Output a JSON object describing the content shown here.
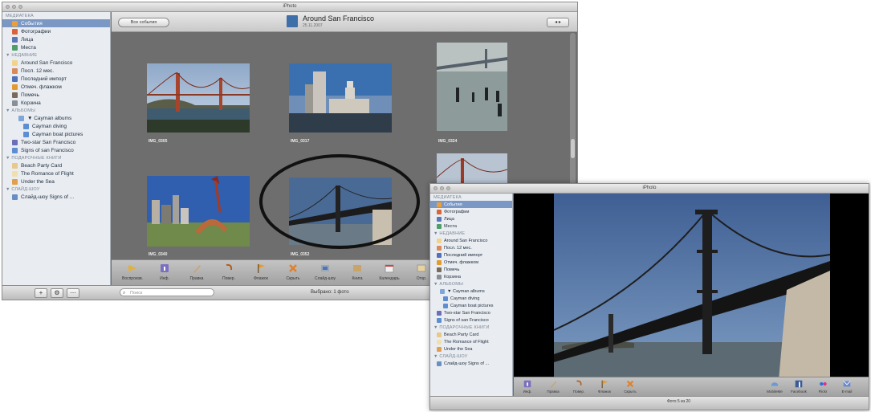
{
  "main_window": {
    "title": "iPhoto",
    "sidebar": {
      "sections": [
        {
          "header": "МЕДИАТЕКА",
          "items": [
            {
              "label": "События",
              "icon": "events-icon",
              "color": "#e9a03a",
              "indent": 0,
              "selected": true
            },
            {
              "label": "Фотографии",
              "icon": "photos-icon",
              "color": "#d9643a",
              "indent": 0
            },
            {
              "label": "Лица",
              "icon": "faces-icon",
              "color": "#5a78b8",
              "indent": 0
            },
            {
              "label": "Места",
              "icon": "places-icon",
              "color": "#4f9e6a",
              "indent": 0
            }
          ]
        },
        {
          "header": "▼ НЕДАВНИЕ",
          "items": [
            {
              "label": "Around San Francisco",
              "icon": "event-album-icon",
              "color": "#f1d48a",
              "indent": 0
            },
            {
              "label": "Посл. 12 мес.",
              "icon": "calendar-icon",
              "color": "#d98a5a",
              "indent": 0
            },
            {
              "label": "Последний импорт",
              "icon": "import-icon",
              "color": "#4f72b8",
              "indent": 0
            },
            {
              "label": "Отмеч. флажком",
              "icon": "flag-icon",
              "color": "#e29b2e",
              "indent": 0
            },
            {
              "label": "Помечь",
              "icon": "flagged-icon",
              "color": "#7a6a5a",
              "indent": 0
            },
            {
              "label": "Корзина",
              "icon": "trash-icon",
              "color": "#8a8f96",
              "indent": 0
            }
          ]
        },
        {
          "header": "▼ АЛЬБОМЫ",
          "items": [
            {
              "label": "▼ Cayman albums",
              "icon": "folder-icon",
              "color": "#7fa6d8",
              "indent": 1
            },
            {
              "label": "Cayman diving",
              "icon": "album-icon",
              "color": "#5d8ed1",
              "indent": 2
            },
            {
              "label": "Cayman boat pictures",
              "icon": "album-icon",
              "color": "#5d8ed1",
              "indent": 2
            },
            {
              "label": "Two-star San Francisco",
              "icon": "smart-album-icon",
              "color": "#6a6fb8",
              "indent": 0
            },
            {
              "label": "Signs of san Francisco",
              "icon": "smart-album-icon",
              "color": "#5d8ed1",
              "indent": 0
            }
          ]
        },
        {
          "header": "▼ ПОДАРОЧНЫЕ КНИГИ",
          "items": [
            {
              "label": "Beach Party Card",
              "icon": "card-icon",
              "color": "#e7c98a",
              "indent": 0
            },
            {
              "label": "The Romance of Flight",
              "icon": "book-icon",
              "color": "#f0e0b0",
              "indent": 0
            },
            {
              "label": "Under the Sea",
              "icon": "calendar-book-icon",
              "color": "#e0a050",
              "indent": 0
            }
          ]
        },
        {
          "header": "▼ СЛАЙД-ШОУ",
          "items": [
            {
              "label": "Слайд-шоу Signs of ...",
              "icon": "slideshow-icon",
              "color": "#6a8ec4",
              "indent": 0
            }
          ]
        }
      ],
      "bottom_buttons": [
        "+",
        "⚙",
        "⋯"
      ]
    },
    "event_header": {
      "back_label": "Все события",
      "title": "Around San Francisco",
      "subtitle": "25.11.2007",
      "nav_label": "◂ ▸"
    },
    "photos": [
      {
        "label": "IMG_0305",
        "scene": "golden-gate"
      },
      {
        "label": "IMG_0317",
        "scene": "ferry-building"
      },
      {
        "label": "IMG_0324",
        "scene": "bay-pilings"
      },
      {
        "label": "IMG_0340",
        "scene": "cupid-arrow"
      },
      {
        "label": "IMG_0352",
        "scene": "bay-bridge"
      },
      {
        "label": "",
        "scene": "golden-gate-partial"
      }
    ],
    "toolbar": [
      {
        "label": "Воспроизв.",
        "icon": "play-icon"
      },
      {
        "label": "Инф.",
        "icon": "info-icon"
      },
      {
        "label": "Правка",
        "icon": "edit-icon"
      },
      {
        "label": "Повер.",
        "icon": "rotate-icon"
      },
      {
        "label": "Флажок",
        "icon": "flag-icon"
      },
      {
        "label": "Скрыть",
        "icon": "hide-icon"
      },
      {
        "label": "Слайд-шоу",
        "icon": "slideshow-icon"
      },
      {
        "label": "Книга",
        "icon": "book-icon"
      },
      {
        "label": "Календарь",
        "icon": "calendar-icon"
      },
      {
        "label": "Откр.",
        "icon": "card-icon"
      }
    ],
    "search_placeholder": "Поиск",
    "status": "Выбрано: 1 фото"
  },
  "second_window": {
    "title": "iPhoto",
    "sidebar": {
      "sections": [
        {
          "header": "МЕДИАТЕКА",
          "items": [
            {
              "label": "События",
              "icon": "events-icon",
              "color": "#e9a03a",
              "indent": 0,
              "selected": true
            },
            {
              "label": "Фотографии",
              "icon": "photos-icon",
              "color": "#d9643a",
              "indent": 0
            },
            {
              "label": "Лица",
              "icon": "faces-icon",
              "color": "#5a78b8",
              "indent": 0
            },
            {
              "label": "Места",
              "icon": "places-icon",
              "color": "#4f9e6a",
              "indent": 0
            }
          ]
        },
        {
          "header": "▼ НЕДАВНИЕ",
          "items": [
            {
              "label": "Around San Francisco",
              "icon": "event-album-icon",
              "color": "#f1d48a",
              "indent": 0
            },
            {
              "label": "Посл. 12 мес.",
              "icon": "calendar-icon",
              "color": "#d98a5a",
              "indent": 0
            },
            {
              "label": "Последний импорт",
              "icon": "import-icon",
              "color": "#4f72b8",
              "indent": 0
            },
            {
              "label": "Отмеч. флажком",
              "icon": "flag-icon",
              "color": "#e29b2e",
              "indent": 0
            },
            {
              "label": "Помечь",
              "icon": "flagged-icon",
              "color": "#7a6a5a",
              "indent": 0
            },
            {
              "label": "Корзина",
              "icon": "trash-icon",
              "color": "#8a8f96",
              "indent": 0
            }
          ]
        },
        {
          "header": "▼ АЛЬБОМЫ",
          "items": [
            {
              "label": "▼ Cayman albums",
              "icon": "folder-icon",
              "color": "#7fa6d8",
              "indent": 1
            },
            {
              "label": "Cayman diving",
              "icon": "album-icon",
              "color": "#5d8ed1",
              "indent": 2
            },
            {
              "label": "Cayman boat pictures",
              "icon": "album-icon",
              "color": "#5d8ed1",
              "indent": 2
            },
            {
              "label": "Two-star San Francisco",
              "icon": "smart-album-icon",
              "color": "#6a6fb8",
              "indent": 0
            },
            {
              "label": "Signs of san Francisco",
              "icon": "smart-album-icon",
              "color": "#5d8ed1",
              "indent": 0
            }
          ]
        },
        {
          "header": "▼ ПОДАРОЧНЫЕ КНИГИ",
          "items": [
            {
              "label": "Beach Party Card",
              "icon": "card-icon",
              "color": "#e7c98a",
              "indent": 0
            },
            {
              "label": "The Romance of Flight",
              "icon": "book-icon",
              "color": "#f0e0b0",
              "indent": 0
            },
            {
              "label": "Under the Sea",
              "icon": "calendar-book-icon",
              "color": "#e0a050",
              "indent": 0
            }
          ]
        },
        {
          "header": "▼ СЛАЙД-ШОУ",
          "items": [
            {
              "label": "Слайд-шоу Signs of ...",
              "icon": "slideshow-icon",
              "color": "#6a8ec4",
              "indent": 0
            }
          ]
        }
      ]
    },
    "toolbar_left": [
      {
        "label": "Инф.",
        "icon": "info-icon"
      },
      {
        "label": "Правка",
        "icon": "edit-icon"
      },
      {
        "label": "Повер.",
        "icon": "rotate-icon"
      },
      {
        "label": "Флажок",
        "icon": "flag-icon"
      },
      {
        "label": "Скрыть",
        "icon": "hide-icon"
      }
    ],
    "toolbar_right": [
      {
        "label": "MobileMe",
        "icon": "mobileme-icon"
      },
      {
        "label": "Facebook",
        "icon": "facebook-icon"
      },
      {
        "label": "Flickr",
        "icon": "flickr-icon"
      },
      {
        "label": "E-mail",
        "icon": "email-icon"
      }
    ],
    "status": "Фото 5 из 20"
  }
}
